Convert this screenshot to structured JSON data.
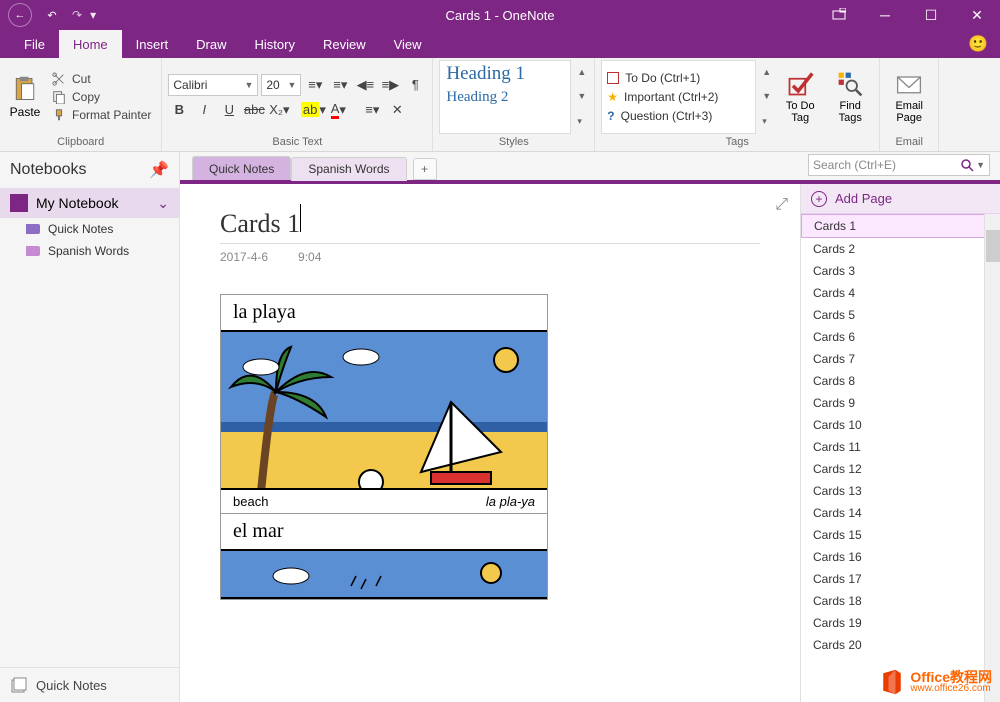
{
  "window": {
    "title": "Cards 1  -  OneNote"
  },
  "menu": {
    "file": "File",
    "home": "Home",
    "insert": "Insert",
    "draw": "Draw",
    "history": "History",
    "review": "Review",
    "view": "View"
  },
  "ribbon": {
    "paste": "Paste",
    "cut": "Cut",
    "copy": "Copy",
    "format_painter": "Format Painter",
    "clipboard_label": "Clipboard",
    "font_name": "Calibri",
    "font_size": "20",
    "basic_text_label": "Basic Text",
    "heading1": "Heading 1",
    "heading2": "Heading 2",
    "styles_label": "Styles",
    "tag_todo": "To Do (Ctrl+1)",
    "tag_important": "Important (Ctrl+2)",
    "tag_question": "Question (Ctrl+3)",
    "tags_label": "Tags",
    "todo_tag": "To Do Tag",
    "find_tags": "Find Tags",
    "email_page": "Email Page",
    "email_label": "Email"
  },
  "sidebar": {
    "header": "Notebooks",
    "notebook": "My Notebook",
    "sections": [
      {
        "label": "Quick Notes",
        "color": "#8C6FC5"
      },
      {
        "label": "Spanish Words",
        "color": "#C68AD2"
      }
    ],
    "bottom": "Quick Notes"
  },
  "section_tabs": {
    "quick": "Quick Notes",
    "spanish": "Spanish Words"
  },
  "search": {
    "placeholder": "Search (Ctrl+E)"
  },
  "page": {
    "title": "Cards 1",
    "date": "2017-4-6",
    "time": "9:04",
    "card1_es": "la playa",
    "card1_en": "beach",
    "card1_ph": "la pla-ya",
    "card2_es": "el mar"
  },
  "pagelist": {
    "add": "Add Page",
    "items": [
      "Cards 1",
      "Cards 2",
      "Cards 3",
      "Cards 4",
      "Cards 5",
      "Cards 6",
      "Cards 7",
      "Cards 8",
      "Cards 9",
      "Cards 10",
      "Cards 11",
      "Cards 12",
      "Cards 13",
      "Cards 14",
      "Cards 15",
      "Cards 16",
      "Cards 17",
      "Cards 18",
      "Cards 19",
      "Cards 20"
    ]
  },
  "watermark": {
    "line1": "Office教程网",
    "line2": "www.office26.com"
  }
}
